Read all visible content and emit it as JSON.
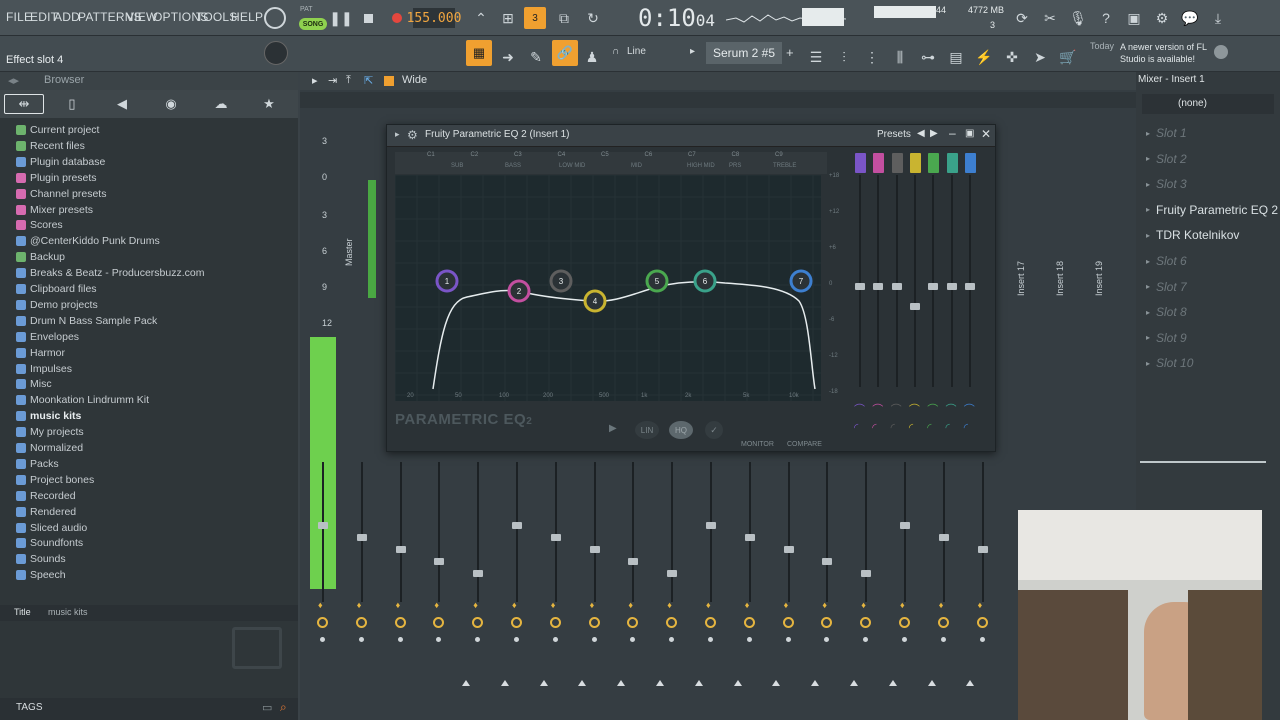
{
  "menu": [
    "FILE",
    "EDIT",
    "ADD",
    "PATTERNS",
    "VIEW",
    "OPTIONS",
    "TOOLS",
    "HELP"
  ],
  "transport": {
    "mode": "SONG",
    "tempo": "155.000",
    "time": "0:10",
    "time_sub": "04",
    "cpu": "44",
    "memory": "4772 MB",
    "polyphony": "3",
    "pat": "PAT"
  },
  "hint": {
    "slot_label": "Effect slot 4"
  },
  "toolbar2": {
    "snap": "Line",
    "channel": "Serum 2 #5",
    "news_when": "Today",
    "news_text": "A newer version of FL Studio is available!"
  },
  "browser": {
    "title": "Browser",
    "items": [
      {
        "label": "Current project",
        "color": "#6db36d"
      },
      {
        "label": "Recent files",
        "color": "#6db36d"
      },
      {
        "label": "Plugin database",
        "color": "#6b9bd6"
      },
      {
        "label": "Plugin presets",
        "color": "#d66bb0"
      },
      {
        "label": "Channel presets",
        "color": "#d66bb0"
      },
      {
        "label": "Mixer presets",
        "color": "#d66bb0"
      },
      {
        "label": "Scores",
        "color": "#d66bb0"
      },
      {
        "label": "@CenterKiddo Punk Drums",
        "color": "#6b9bd6"
      },
      {
        "label": "Backup",
        "color": "#6db36d"
      },
      {
        "label": "Breaks & Beatz - Producersbuzz.com",
        "color": "#6b9bd6"
      },
      {
        "label": "Clipboard files",
        "color": "#6b9bd6"
      },
      {
        "label": "Demo projects",
        "color": "#6b9bd6"
      },
      {
        "label": "Drum N Bass Sample Pack",
        "color": "#6b9bd6"
      },
      {
        "label": "Envelopes",
        "color": "#6b9bd6"
      },
      {
        "label": "Harmor",
        "color": "#6b9bd6"
      },
      {
        "label": "Impulses",
        "color": "#6b9bd6"
      },
      {
        "label": "Misc",
        "color": "#6b9bd6"
      },
      {
        "label": "Moonkation Lindrumm Kit",
        "color": "#6b9bd6"
      },
      {
        "label": "music kits",
        "color": "#6b9bd6"
      },
      {
        "label": "My projects",
        "color": "#6b9bd6"
      },
      {
        "label": "Normalized",
        "color": "#6b9bd6"
      },
      {
        "label": "Packs",
        "color": "#6b9bd6"
      },
      {
        "label": "Project bones",
        "color": "#6b9bd6"
      },
      {
        "label": "Recorded",
        "color": "#6b9bd6"
      },
      {
        "label": "Rendered",
        "color": "#6b9bd6"
      },
      {
        "label": "Sliced audio",
        "color": "#6b9bd6"
      },
      {
        "label": "Soundfonts",
        "color": "#6b9bd6"
      },
      {
        "label": "Sounds",
        "color": "#6b9bd6"
      },
      {
        "label": "Speech",
        "color": "#6b9bd6"
      }
    ],
    "footer_title": "Title",
    "footer_value": "music kits",
    "tags": "TAGS"
  },
  "playlist": {
    "view": "Wide"
  },
  "mixer": {
    "title": "Mixer - Insert 1",
    "preset": "(none)",
    "slots": [
      "Slot 1",
      "Slot 2",
      "Slot 3",
      "Fruity Parametric EQ 2",
      "TDR Kotelnikov",
      "Slot 6",
      "Slot 7",
      "Slot 8",
      "Slot 9",
      "Slot 10"
    ],
    "strip_labels": [
      "Master",
      "Insert 17",
      "Insert 18",
      "Insert 19"
    ],
    "db_scale": [
      "3",
      "0",
      "3",
      "6",
      "9",
      "12"
    ]
  },
  "eq": {
    "title": "Fruity Parametric EQ 2 (Insert 1)",
    "presets": "Presets",
    "brand": "PARAMETRIC EQ",
    "brand_sub": "2",
    "monitor": "MONITOR",
    "compare": "COMPARE",
    "lin": "LIN",
    "hq": "HQ",
    "notes": [
      "C1",
      "C2",
      "C3",
      "C4",
      "C5",
      "C6",
      "C7",
      "C8",
      "C9"
    ],
    "regions": [
      "SUB",
      "BASS",
      "LOW MID",
      "MID",
      "HIGH MID",
      "PRS",
      "TREBLE"
    ],
    "freqs": [
      "20",
      "50",
      "100",
      "200",
      "500",
      "1k",
      "2k",
      "5k",
      "10k"
    ],
    "db_right": [
      "+18",
      "+12",
      "+6",
      "0",
      "-6",
      "-12",
      "-18"
    ],
    "bands": [
      {
        "n": "1",
        "color": "#7a55c7"
      },
      {
        "n": "2",
        "color": "#c34fa0"
      },
      {
        "n": "3",
        "color": "#5e5e5e"
      },
      {
        "n": "4",
        "color": "#c9b430"
      },
      {
        "n": "5",
        "color": "#4aa84f"
      },
      {
        "n": "6",
        "color": "#3aa28a"
      },
      {
        "n": "7",
        "color": "#3d7fd0"
      }
    ]
  }
}
